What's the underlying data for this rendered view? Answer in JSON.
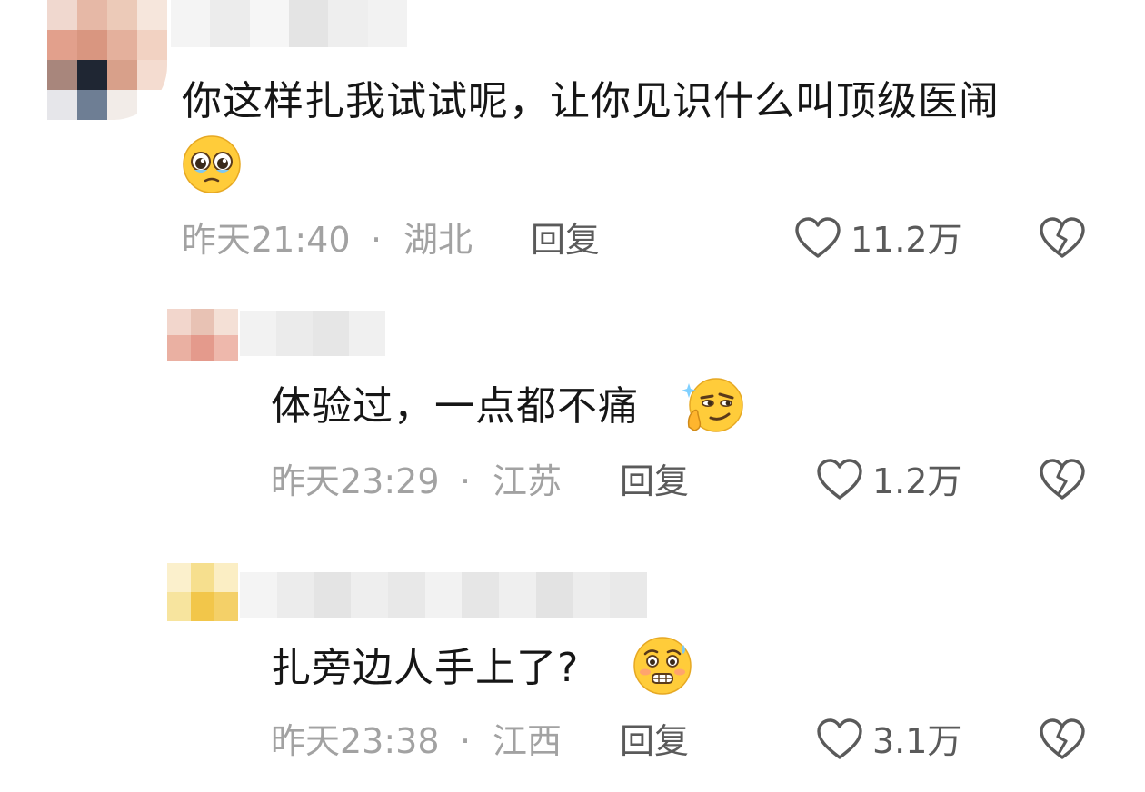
{
  "comments": [
    {
      "text": "你这样扎我试试呢，让你见识什么叫顶级医闹",
      "time": "昨天21:40",
      "separator": "·",
      "location": "湖北",
      "reply_label": "回复",
      "likes": "11.2万",
      "emoji": "pleading-face-icon"
    },
    {
      "text": "体验过，一点都不痛",
      "time": "昨天23:29",
      "separator": "·",
      "location": "江苏",
      "reply_label": "回复",
      "likes": "1.2万",
      "emoji": "smirk-thinking-face-icon"
    },
    {
      "text": "扎旁边人手上了?",
      "time": "昨天23:38",
      "separator": "·",
      "location": "江西",
      "reply_label": "回复",
      "likes": "3.1万",
      "emoji": "worried-grimace-face-icon"
    }
  ],
  "colors": {
    "text": "#161616",
    "meta": "#a2a2a2",
    "action": "#5a5a5a",
    "emoji_yellow": "#ffcc3a"
  }
}
